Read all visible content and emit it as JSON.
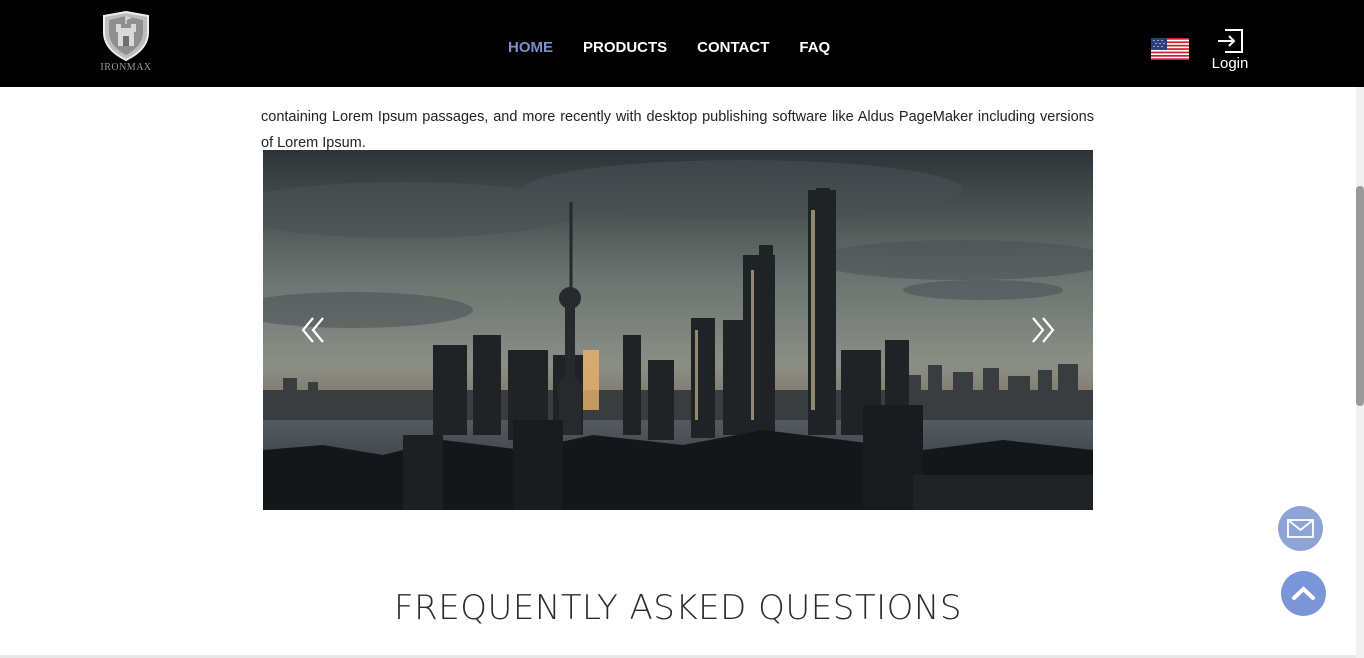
{
  "brand": {
    "logo_text": "IRONMAX"
  },
  "nav": {
    "items": [
      {
        "label": "HOME",
        "active": true
      },
      {
        "label": "PRODUCTS",
        "active": false
      },
      {
        "label": "CONTACT",
        "active": false
      },
      {
        "label": "FAQ",
        "active": false
      }
    ],
    "active_color": "#7b8fc9"
  },
  "header": {
    "login_label": "Login",
    "flag": "us-flag-icon"
  },
  "content": {
    "paragraph": "containing Lorem Ipsum passages, and more recently with desktop publishing software like Aldus PageMaker including versions of Lorem Ipsum."
  },
  "carousel": {
    "prev_icon": "double-chevron-left-icon",
    "next_icon": "double-chevron-right-icon"
  },
  "faq": {
    "title": "FREQUENTLY ASKED QUESTIONS"
  },
  "floating": {
    "mail_icon": "mail-icon",
    "top_icon": "chevron-up-icon",
    "color": "#7b96d8"
  }
}
